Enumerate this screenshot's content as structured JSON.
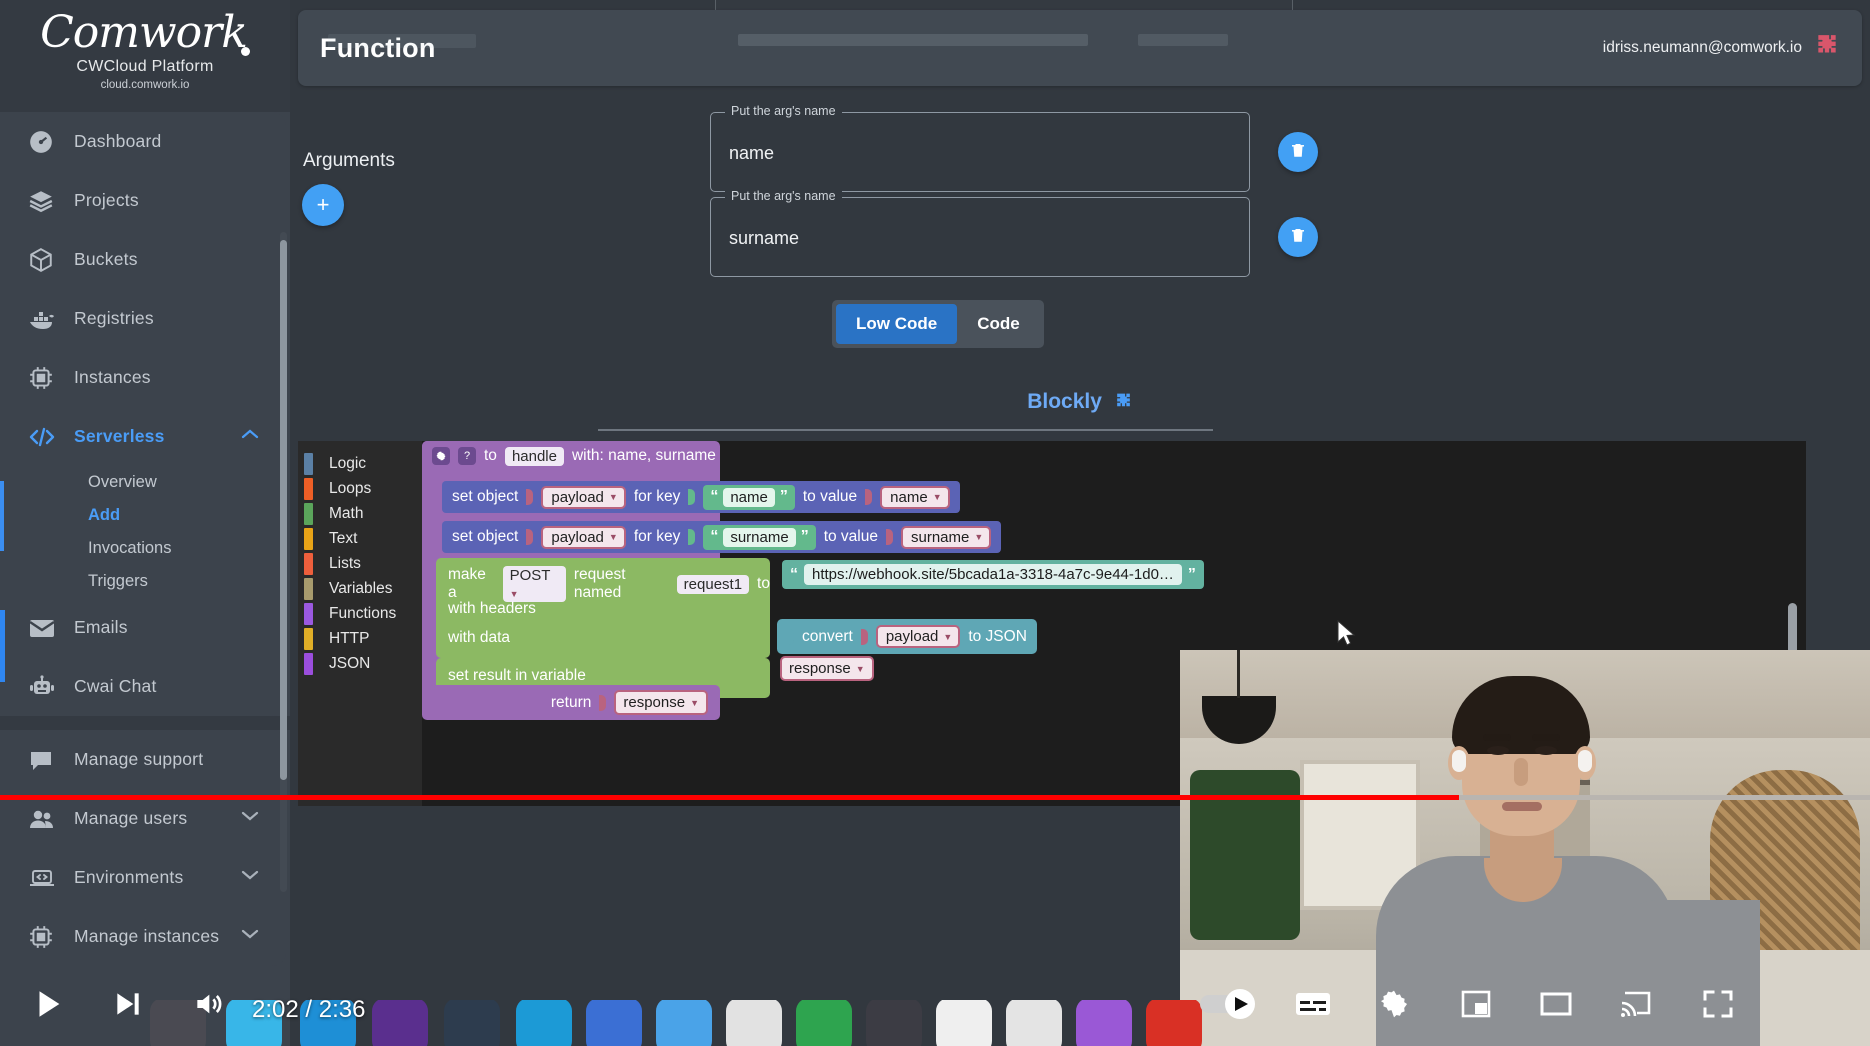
{
  "brand": {
    "script": "Comwork",
    "name": "CWCloud Platform",
    "url": "cloud.comwork.io"
  },
  "sidebar": {
    "items": [
      {
        "label": "Dashboard",
        "icon": "gauge-icon"
      },
      {
        "label": "Projects",
        "icon": "layers-icon"
      },
      {
        "label": "Buckets",
        "icon": "box-icon"
      },
      {
        "label": "Registries",
        "icon": "docker-icon"
      },
      {
        "label": "Instances",
        "icon": "chip-icon"
      },
      {
        "label": "Serverless",
        "icon": "code-brackets-icon",
        "active": true,
        "chevron": "chevron-up-icon"
      }
    ],
    "serverless_subitems": [
      {
        "label": "Overview"
      },
      {
        "label": "Add",
        "selected": true
      },
      {
        "label": "Invocations"
      },
      {
        "label": "Triggers"
      }
    ],
    "items2": [
      {
        "label": "Emails",
        "icon": "envelope-icon"
      },
      {
        "label": "Cwai Chat",
        "icon": "robot-icon"
      }
    ],
    "items3": [
      {
        "label": "Manage support",
        "icon": "chat-bubble-icon"
      },
      {
        "label": "Manage users",
        "icon": "users-icon",
        "chevron": "chevron-down-icon"
      },
      {
        "label": "Environments",
        "icon": "laptop-code-icon",
        "chevron": "chevron-down-icon"
      },
      {
        "label": "Manage instances",
        "icon": "chip-icon",
        "chevron": "chevron-down-icon"
      }
    ]
  },
  "header": {
    "title": "Function",
    "user_email": "idriss.neumann@comwork.io",
    "brand_icon": "puzzle-piece-icon",
    "brand_icon_color": "#d9566b"
  },
  "arguments": {
    "label": "Arguments",
    "add_button": "+",
    "rows": [
      {
        "legend": "Put the arg's name",
        "value": "name",
        "delete_icon": "trash-icon"
      },
      {
        "legend": "Put the arg's name",
        "value": "surname",
        "delete_icon": "trash-icon"
      }
    ]
  },
  "mode_toggle": {
    "options": [
      {
        "label": "Low Code",
        "selected": true
      },
      {
        "label": "Code",
        "selected": false
      }
    ],
    "accent": "#2a73c5"
  },
  "blockly": {
    "title": "Blockly",
    "title_icon": "puzzle-piece-icon",
    "toolbox": [
      {
        "label": "Logic",
        "color": "#5b80a5"
      },
      {
        "label": "Loops",
        "color": "#ee5f26"
      },
      {
        "label": "Math",
        "color": "#5ba55b"
      },
      {
        "label": "Text",
        "color": "#e8a317"
      },
      {
        "label": "Lists",
        "color": "#ee5f3c"
      },
      {
        "label": "Variables",
        "color": "#a89b6d"
      },
      {
        "label": "Functions",
        "color": "#9b59e0"
      },
      {
        "label": "HTTP",
        "color": "#e0ae27"
      },
      {
        "label": "JSON",
        "color": "#9b4edd"
      }
    ],
    "blocks": {
      "function_header": {
        "gear_icon": "gear-icon",
        "help_icon": "question-mark-icon",
        "to_label": "to",
        "name_field": "handle",
        "with_label": "with: name, surname"
      },
      "set_object_1": {
        "prefix": "set object",
        "object": "payload",
        "for_key": "for key",
        "key": "name",
        "to_value": "to value",
        "value": "name"
      },
      "set_object_2": {
        "prefix": "set object",
        "object": "payload",
        "for_key": "for key",
        "key": "surname",
        "to_value": "to value",
        "value": "surname"
      },
      "http_request": {
        "make_a": "make a",
        "method": "POST",
        "request_named": "request named",
        "request_name": "request1",
        "to": "to",
        "url": "https://webhook.site/5bcada1a-3318-4a7c-9e44-1d0…",
        "with_headers": "with headers",
        "with_data": "with data",
        "set_result": "set result in variable",
        "result_var": "response"
      },
      "convert_json": {
        "convert": "convert",
        "value": "payload",
        "to_json": "to JSON"
      },
      "return_block": {
        "label": "return",
        "value": "response"
      }
    }
  },
  "player": {
    "time": "2:02 / 2:36",
    "progress_percent": 78,
    "buttons": [
      {
        "name": "play-button",
        "icon": "play-icon"
      },
      {
        "name": "next-button",
        "icon": "next-track-icon"
      },
      {
        "name": "volume-button",
        "icon": "volume-icon"
      },
      {
        "name": "autoplay-toggle",
        "icon": "autoplay-toggle-icon"
      },
      {
        "name": "subtitles-button",
        "icon": "subtitles-icon"
      },
      {
        "name": "settings-button",
        "icon": "gear-icon"
      },
      {
        "name": "miniplayer-button",
        "icon": "miniplayer-icon"
      },
      {
        "name": "theater-button",
        "icon": "theater-mode-icon"
      },
      {
        "name": "cast-button",
        "icon": "cast-icon"
      },
      {
        "name": "fullscreen-button",
        "icon": "fullscreen-icon"
      }
    ],
    "progress_color": "#ff0000"
  },
  "cursor": {
    "icon": "mouse-pointer-icon"
  }
}
